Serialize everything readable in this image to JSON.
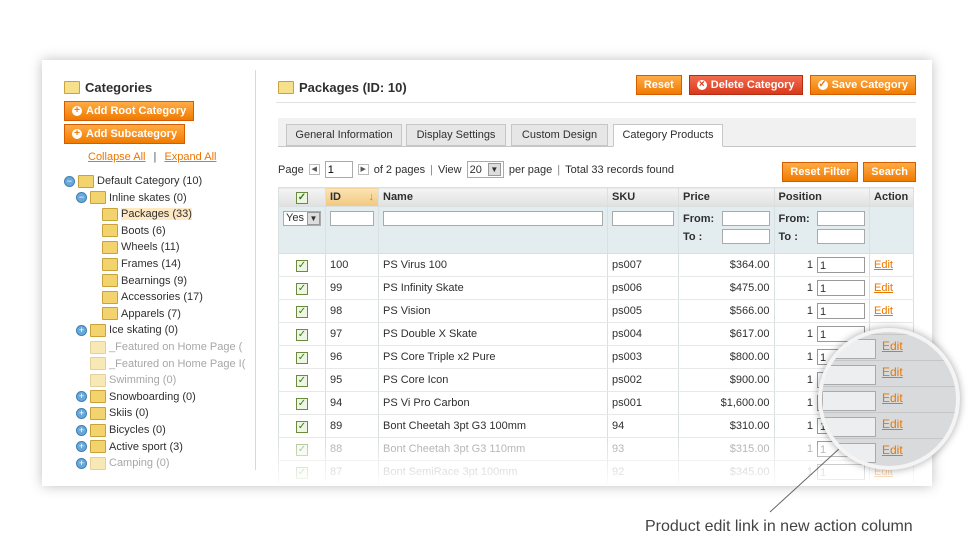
{
  "left": {
    "title": "Categories",
    "add_root": "Add Root Category",
    "add_sub": "Add Subcategory",
    "collapse": "Collapse All",
    "separator": "|",
    "expand": "Expand All",
    "tree": [
      {
        "label": "Default Category (10)",
        "level": 0,
        "toggle": "−",
        "state": "normal"
      },
      {
        "label": "Inline skates (0)",
        "level": 1,
        "toggle": "−",
        "state": "normal"
      },
      {
        "label": "Packages (33)",
        "level": 2,
        "toggle": "",
        "state": "selected"
      },
      {
        "label": "Boots (6)",
        "level": 2,
        "toggle": "",
        "state": "normal"
      },
      {
        "label": "Wheels (11)",
        "level": 2,
        "toggle": "",
        "state": "normal"
      },
      {
        "label": "Frames (14)",
        "level": 2,
        "toggle": "",
        "state": "normal"
      },
      {
        "label": "Bearnings (9)",
        "level": 2,
        "toggle": "",
        "state": "normal"
      },
      {
        "label": "Accessories (17)",
        "level": 2,
        "toggle": "",
        "state": "normal"
      },
      {
        "label": "Apparels (7)",
        "level": 2,
        "toggle": "",
        "state": "normal"
      },
      {
        "label": "Ice skating (0)",
        "level": 1,
        "toggle": "+",
        "state": "normal"
      },
      {
        "label": "_Featured on Home Page (",
        "level": 1,
        "toggle": "",
        "state": "dim"
      },
      {
        "label": "_Featured on Home Page I(",
        "level": 1,
        "toggle": "",
        "state": "dim"
      },
      {
        "label": "Swimming (0)",
        "level": 1,
        "toggle": "",
        "state": "dim"
      },
      {
        "label": "Snowboarding (0)",
        "level": 1,
        "toggle": "+",
        "state": "normal"
      },
      {
        "label": "Skiis (0)",
        "level": 1,
        "toggle": "+",
        "state": "normal"
      },
      {
        "label": "Bicycles (0)",
        "level": 1,
        "toggle": "+",
        "state": "normal"
      },
      {
        "label": "Active sport (3)",
        "level": 1,
        "toggle": "+",
        "state": "normal"
      },
      {
        "label": "Camping (0)",
        "level": 1,
        "toggle": "+",
        "state": "dim"
      }
    ]
  },
  "header": {
    "title": "Packages (ID: 10)",
    "reset": "Reset",
    "delete": "Delete Category",
    "save": "Save Category"
  },
  "tabs": [
    "General Information",
    "Display Settings",
    "Custom Design",
    "Category Products"
  ],
  "pager": {
    "page_label": "Page",
    "page_value": "1",
    "of_pages": "of 2 pages",
    "sep": "|",
    "view_label": "View",
    "view_value": "20",
    "per_page": "per page",
    "total": "Total 33 records found",
    "reset_filter": "Reset Filter",
    "search": "Search"
  },
  "grid": {
    "columns": [
      "ID",
      "Name",
      "SKU",
      "Price",
      "Position",
      "Action"
    ],
    "filter_yes": "Yes",
    "from": "From:",
    "to": "To :",
    "rows": [
      {
        "id": "100",
        "name": "PS Virus 100",
        "sku": "ps007",
        "price": "$364.00",
        "pos": "1",
        "pos_input": "1",
        "action": "Edit"
      },
      {
        "id": "99",
        "name": "PS Infinity Skate",
        "sku": "ps006",
        "price": "$475.00",
        "pos": "1",
        "pos_input": "1",
        "action": "Edit"
      },
      {
        "id": "98",
        "name": "PS Vision",
        "sku": "ps005",
        "price": "$566.00",
        "pos": "1",
        "pos_input": "1",
        "action": "Edit"
      },
      {
        "id": "97",
        "name": "PS Double X Skate",
        "sku": "ps004",
        "price": "$617.00",
        "pos": "1",
        "pos_input": "1",
        "action": "Edit"
      },
      {
        "id": "96",
        "name": "PS Core Triple x2 Pure",
        "sku": "ps003",
        "price": "$800.00",
        "pos": "1",
        "pos_input": "1",
        "action": "Edit"
      },
      {
        "id": "95",
        "name": "PS Core Icon",
        "sku": "ps002",
        "price": "$900.00",
        "pos": "1",
        "pos_input": "1",
        "action": "Edit"
      },
      {
        "id": "94",
        "name": "PS Vi Pro Carbon",
        "sku": "ps001",
        "price": "$1,600.00",
        "pos": "1",
        "pos_input": "1",
        "action": "Edit"
      },
      {
        "id": "89",
        "name": "Bont Cheetah 3pt G3 100mm",
        "sku": "94",
        "price": "$310.00",
        "pos": "1",
        "pos_input": "1",
        "action": "Edit"
      },
      {
        "id": "88",
        "name": "Bont Cheetah 3pt G3 110mm",
        "sku": "93",
        "price": "$315.00",
        "pos": "1",
        "pos_input": "1",
        "action": "Edit"
      },
      {
        "id": "87",
        "name": "Bont SemiRace 3pt 100mm",
        "sku": "92",
        "price": "$345.00",
        "pos": "1",
        "pos_input": "1",
        "action": "Edit"
      }
    ]
  },
  "magnifier_edits": [
    "Edit",
    "Edit",
    "Edit",
    "Edit",
    "Edit"
  ],
  "caption": "Product edit link in new action column"
}
